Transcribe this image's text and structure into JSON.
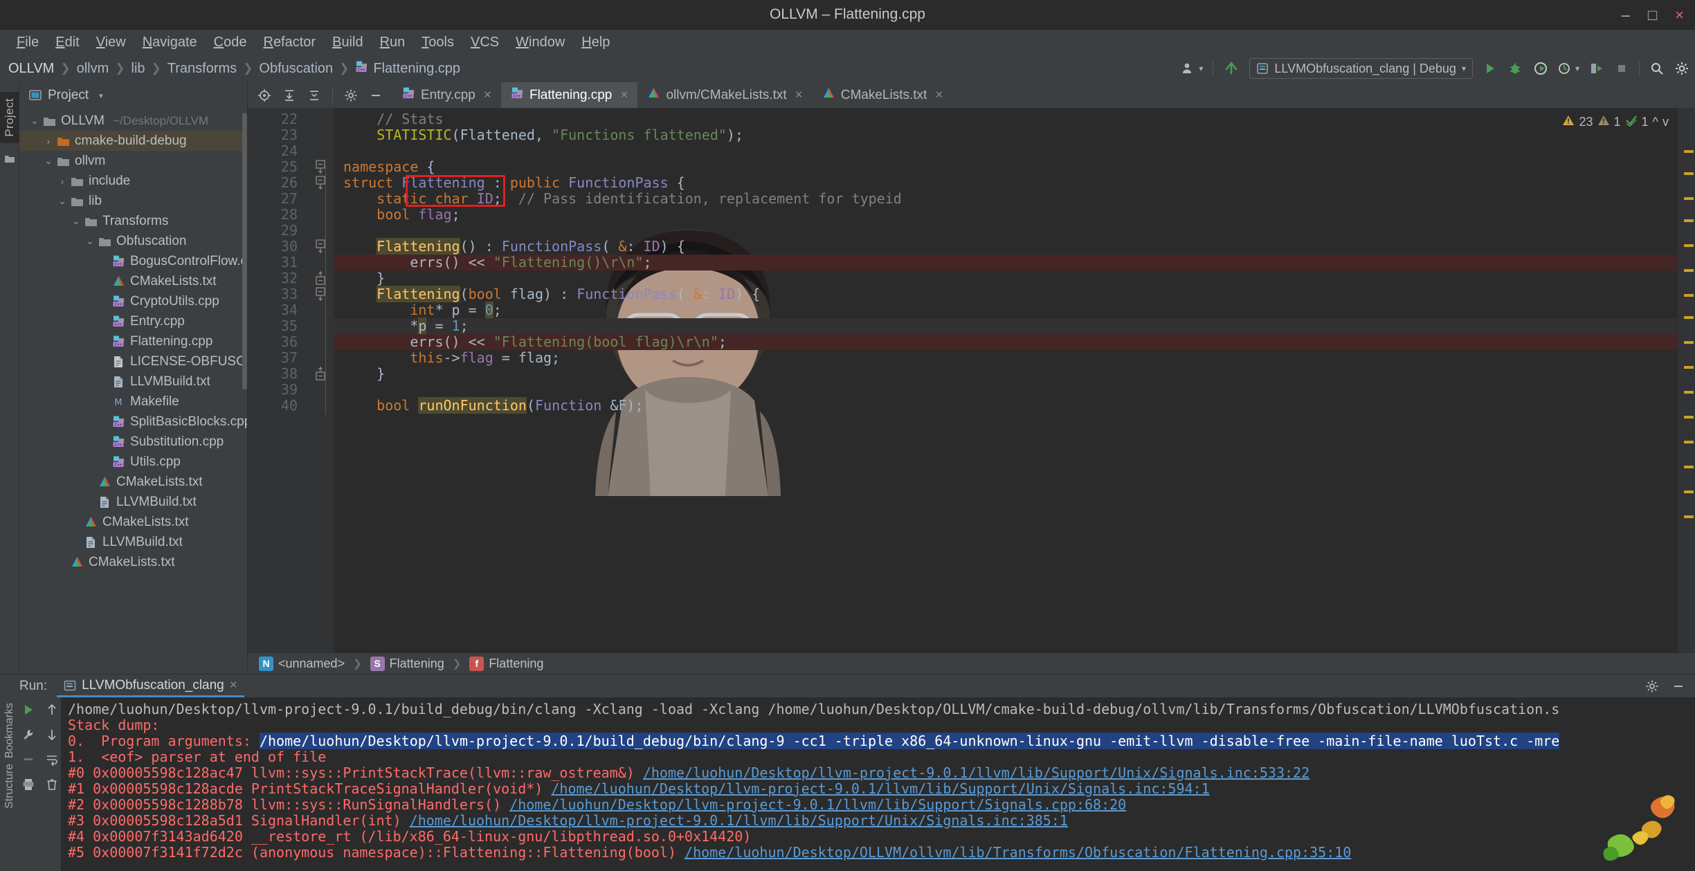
{
  "window": {
    "title": "OLLVM – Flattening.cpp",
    "minimize": "–",
    "maximize": "□",
    "close": "×"
  },
  "menubar": {
    "items": [
      "File",
      "Edit",
      "View",
      "Navigate",
      "Code",
      "Refactor",
      "Build",
      "Run",
      "Tools",
      "VCS",
      "Window",
      "Help"
    ]
  },
  "navbar": {
    "crumbs": [
      "OLLVM",
      "ollvm",
      "lib",
      "Transforms",
      "Obfuscation",
      "Flattening.cpp"
    ],
    "run_config": "LLVMObfuscation_clang | Debug",
    "run_config_icons": [
      "run-icon",
      "debug-icon",
      "run-with-coverage-icon",
      "profile-icon",
      "attach-icon",
      "stop-icon"
    ],
    "right_icons": [
      "search-icon",
      "settings-icon"
    ]
  },
  "sidebar": {
    "strip_label": "Project",
    "header": "Project",
    "tree": [
      {
        "depth": 0,
        "arrow": "v",
        "icon": "folder-icon",
        "label": "OLLVM",
        "sub": "~/Desktop/OLLVM",
        "selected": false
      },
      {
        "depth": 1,
        "arrow": ">",
        "icon": "folder-orange-icon",
        "label": "cmake-build-debug",
        "sub": "",
        "selected": true
      },
      {
        "depth": 1,
        "arrow": "v",
        "icon": "folder-icon",
        "label": "ollvm",
        "sub": "",
        "selected": false
      },
      {
        "depth": 2,
        "arrow": ">",
        "icon": "folder-icon",
        "label": "include",
        "sub": "",
        "selected": false
      },
      {
        "depth": 2,
        "arrow": "v",
        "icon": "folder-icon",
        "label": "lib",
        "sub": "",
        "selected": false
      },
      {
        "depth": 3,
        "arrow": "v",
        "icon": "folder-icon",
        "label": "Transforms",
        "sub": "",
        "selected": false
      },
      {
        "depth": 4,
        "arrow": "v",
        "icon": "folder-icon",
        "label": "Obfuscation",
        "sub": "",
        "selected": false
      },
      {
        "depth": 5,
        "arrow": "",
        "icon": "cpp-file-icon",
        "label": "BogusControlFlow.cpp",
        "sub": "",
        "selected": false
      },
      {
        "depth": 5,
        "arrow": "",
        "icon": "cmake-file-icon",
        "label": "CMakeLists.txt",
        "sub": "",
        "selected": false
      },
      {
        "depth": 5,
        "arrow": "",
        "icon": "cpp-file-icon",
        "label": "CryptoUtils.cpp",
        "sub": "",
        "selected": false
      },
      {
        "depth": 5,
        "arrow": "",
        "icon": "cpp-file-icon",
        "label": "Entry.cpp",
        "sub": "",
        "selected": false
      },
      {
        "depth": 5,
        "arrow": "",
        "icon": "cpp-file-icon",
        "label": "Flattening.cpp",
        "sub": "",
        "selected": false
      },
      {
        "depth": 5,
        "arrow": "",
        "icon": "text-file-icon",
        "label": "LICENSE-OBFUSCATOR.TXT",
        "sub": "",
        "selected": false
      },
      {
        "depth": 5,
        "arrow": "",
        "icon": "txt-file-icon",
        "label": "LLVMBuild.txt",
        "sub": "",
        "selected": false
      },
      {
        "depth": 5,
        "arrow": "",
        "icon": "makefile-icon",
        "label": "Makefile",
        "sub": "",
        "selected": false
      },
      {
        "depth": 5,
        "arrow": "",
        "icon": "cpp-file-icon",
        "label": "SplitBasicBlocks.cpp",
        "sub": "",
        "selected": false
      },
      {
        "depth": 5,
        "arrow": "",
        "icon": "cpp-file-icon",
        "label": "Substitution.cpp",
        "sub": "",
        "selected": false
      },
      {
        "depth": 5,
        "arrow": "",
        "icon": "cpp-file-icon",
        "label": "Utils.cpp",
        "sub": "",
        "selected": false
      },
      {
        "depth": 4,
        "arrow": "",
        "icon": "cmake-file-icon",
        "label": "CMakeLists.txt",
        "sub": "",
        "selected": false
      },
      {
        "depth": 4,
        "arrow": "",
        "icon": "txt-file-icon",
        "label": "LLVMBuild.txt",
        "sub": "",
        "selected": false
      },
      {
        "depth": 3,
        "arrow": "",
        "icon": "cmake-file-icon",
        "label": "CMakeLists.txt",
        "sub": "",
        "selected": false
      },
      {
        "depth": 3,
        "arrow": "",
        "icon": "txt-file-icon",
        "label": "LLVMBuild.txt",
        "sub": "",
        "selected": false
      },
      {
        "depth": 2,
        "arrow": "",
        "icon": "cmake-file-icon",
        "label": "CMakeLists.txt",
        "sub": "",
        "selected": false
      }
    ]
  },
  "editor": {
    "toolbar_icons": [
      "locate-icon",
      "expand-all-icon",
      "collapse-all-icon",
      "settings-icon",
      "hide-icon"
    ],
    "tabs": [
      {
        "label": "Entry.cpp",
        "icon": "cpp-file-icon",
        "active": false,
        "close": "×"
      },
      {
        "label": "Flattening.cpp",
        "icon": "cpp-file-icon",
        "active": true,
        "close": "×"
      },
      {
        "label": "ollvm/CMakeLists.txt",
        "icon": "cmake-file-icon",
        "active": false,
        "close": "×"
      },
      {
        "label": "CMakeLists.txt",
        "icon": "cmake-file-icon",
        "active": false,
        "close": "×"
      }
    ],
    "inspection": {
      "warnings": "23",
      "weak_warnings": "1",
      "typos": "1",
      "up": "^",
      "down": "v"
    },
    "first_line": 22,
    "lines": [
      {
        "n": 22,
        "marker": "",
        "fold": "",
        "bg": "",
        "tokens": [
          {
            "t": "    ",
            "c": "t"
          },
          {
            "t": "// Stats",
            "c": "c"
          }
        ]
      },
      {
        "n": 23,
        "marker": "",
        "fold": "",
        "bg": "",
        "tokens": [
          {
            "t": "    ",
            "c": "t"
          },
          {
            "t": "STATISTIC",
            "c": "mac"
          },
          {
            "t": "(Flattened, ",
            "c": "t"
          },
          {
            "t": "\"Functions flattened\"",
            "c": "s"
          },
          {
            "t": ");",
            "c": "t"
          }
        ]
      },
      {
        "n": 24,
        "marker": "",
        "fold": "",
        "bg": "",
        "tokens": []
      },
      {
        "n": 25,
        "marker": "",
        "fold": "minus",
        "bg": "",
        "tokens": [
          {
            "t": "namespace",
            "c": "k"
          },
          {
            "t": " {",
            "c": "t"
          }
        ]
      },
      {
        "n": 26,
        "marker": "override",
        "fold": "minus",
        "bg": "",
        "tokens": [
          {
            "t": "struct",
            "c": "k"
          },
          {
            "t": " ",
            "c": "t"
          },
          {
            "t": "Flattening",
            "c": "ty"
          },
          {
            "t": " : ",
            "c": "t"
          },
          {
            "t": "public",
            "c": "k"
          },
          {
            "t": " ",
            "c": "t"
          },
          {
            "t": "FunctionPass",
            "c": "ty"
          },
          {
            "t": " {",
            "c": "t"
          }
        ]
      },
      {
        "n": 27,
        "marker": "impl",
        "fold": "",
        "bg": "",
        "tokens": [
          {
            "t": "    ",
            "c": "t"
          },
          {
            "t": "static",
            "c": "k"
          },
          {
            "t": " ",
            "c": "t"
          },
          {
            "t": "char",
            "c": "k"
          },
          {
            "t": " ",
            "c": "t"
          },
          {
            "t": "ID",
            "c": "fld"
          },
          {
            "t": ";  ",
            "c": "t"
          },
          {
            "t": "// Pass identification, replacement for typeid",
            "c": "c"
          }
        ]
      },
      {
        "n": 28,
        "marker": "",
        "fold": "",
        "bg": "",
        "tokens": [
          {
            "t": "    ",
            "c": "t"
          },
          {
            "t": "bool",
            "c": "k"
          },
          {
            "t": " ",
            "c": "t"
          },
          {
            "t": "flag",
            "c": "fld"
          },
          {
            "t": ";",
            "c": "t"
          }
        ]
      },
      {
        "n": 29,
        "marker": "",
        "fold": "",
        "bg": "",
        "tokens": []
      },
      {
        "n": 30,
        "marker": "",
        "fold": "minus",
        "bg": "",
        "tokens": [
          {
            "t": "    ",
            "c": "t"
          },
          {
            "t": "Flattening",
            "c": "fn hl"
          },
          {
            "t": "() : ",
            "c": "t"
          },
          {
            "t": "FunctionPass",
            "c": "ty"
          },
          {
            "t": "( ",
            "c": "t"
          },
          {
            "t": "&",
            "c": "k"
          },
          {
            "t": ": ",
            "c": "t"
          },
          {
            "t": "ID",
            "c": "fld"
          },
          {
            "t": ") {",
            "c": "t"
          }
        ]
      },
      {
        "n": 31,
        "marker": "breakpoint",
        "fold": "",
        "bg": "err",
        "tokens": [
          {
            "t": "        ",
            "c": "t"
          },
          {
            "t": "errs",
            "c": "t"
          },
          {
            "t": "() << ",
            "c": "t"
          },
          {
            "t": "\"Flattening()\\r\\n\"",
            "c": "s"
          },
          {
            "t": ";",
            "c": "t"
          }
        ]
      },
      {
        "n": 32,
        "marker": "",
        "fold": "plus",
        "bg": "",
        "tokens": [
          {
            "t": "    }",
            "c": "t"
          }
        ]
      },
      {
        "n": 33,
        "marker": "",
        "fold": "minus",
        "bg": "",
        "tokens": [
          {
            "t": "    ",
            "c": "t"
          },
          {
            "t": "Flattening",
            "c": "fn hl"
          },
          {
            "t": "(",
            "c": "t"
          },
          {
            "t": "bool",
            "c": "k"
          },
          {
            "t": " flag) : ",
            "c": "t"
          },
          {
            "t": "FunctionPass",
            "c": "ty"
          },
          {
            "t": "( ",
            "c": "t"
          },
          {
            "t": "&",
            "c": "k"
          },
          {
            "t": ": ",
            "c": "t"
          },
          {
            "t": "ID",
            "c": "fld"
          },
          {
            "t": ") {",
            "c": "t"
          }
        ]
      },
      {
        "n": 34,
        "marker": "",
        "fold": "",
        "bg": "",
        "tokens": [
          {
            "t": "        ",
            "c": "t"
          },
          {
            "t": "int",
            "c": "k"
          },
          {
            "t": "* p = ",
            "c": "t"
          },
          {
            "t": "0",
            "c": "num hlnum"
          },
          {
            "t": ";",
            "c": "t"
          }
        ]
      },
      {
        "n": 35,
        "marker": "",
        "fold": "",
        "bg": "cur",
        "tokens": [
          {
            "t": "        *",
            "c": "t"
          },
          {
            "t": "p",
            "c": "t hl"
          },
          {
            "t": " = ",
            "c": "t"
          },
          {
            "t": "1",
            "c": "num"
          },
          {
            "t": ";",
            "c": "t"
          }
        ]
      },
      {
        "n": 36,
        "marker": "breakpoint",
        "fold": "",
        "bg": "err",
        "tokens": [
          {
            "t": "        ",
            "c": "t"
          },
          {
            "t": "errs",
            "c": "t"
          },
          {
            "t": "() << ",
            "c": "t"
          },
          {
            "t": "\"Flattening(bool flag)\\r\\n\"",
            "c": "s"
          },
          {
            "t": ";",
            "c": "t"
          }
        ]
      },
      {
        "n": 37,
        "marker": "",
        "fold": "",
        "bg": "",
        "tokens": [
          {
            "t": "        ",
            "c": "t"
          },
          {
            "t": "this",
            "c": "k"
          },
          {
            "t": "->",
            "c": "t"
          },
          {
            "t": "flag",
            "c": "fld"
          },
          {
            "t": " = flag;",
            "c": "t"
          }
        ]
      },
      {
        "n": 38,
        "marker": "",
        "fold": "plus",
        "bg": "",
        "tokens": [
          {
            "t": "    }",
            "c": "t"
          }
        ]
      },
      {
        "n": 39,
        "marker": "",
        "fold": "",
        "bg": "",
        "tokens": []
      },
      {
        "n": 40,
        "marker": "override-green",
        "fold": "",
        "bg": "",
        "tokens": [
          {
            "t": "    ",
            "c": "t"
          },
          {
            "t": "bool",
            "c": "k"
          },
          {
            "t": " ",
            "c": "t"
          },
          {
            "t": "runOnFunction",
            "c": "fn hl"
          },
          {
            "t": "(",
            "c": "t"
          },
          {
            "t": "Function",
            "c": "ty"
          },
          {
            "t": " &F);",
            "c": "t"
          }
        ]
      }
    ],
    "breadcrumb": [
      {
        "badge": "N",
        "label": "<unnamed>",
        "color": "#3592c4"
      },
      {
        "badge": "S",
        "label": "Flattening",
        "color": "#9876aa"
      },
      {
        "badge": "f",
        "label": "Flattening",
        "color": "#c75450"
      }
    ]
  },
  "run_panel": {
    "label": "Run:",
    "tab": "LLVMObfuscation_clang",
    "tab_close": "×",
    "header_icons": [
      "settings-icon",
      "minimize-icon"
    ],
    "tool_icons": [
      "rerun-icon",
      "scroll-up-icon",
      "wrench-icon",
      "scroll-down-icon",
      "stop-icon",
      "soft-wrap-icon",
      "print-icon",
      "clear-all-icon"
    ],
    "left_strip_labels": [
      "Bookmarks",
      "Structure"
    ],
    "console": [
      {
        "cls": "",
        "parts": [
          {
            "t": "/home/luohun/Desktop/llvm-project-9.0.1/build_debug/bin/clang -Xclang -load -Xclang /home/luohun/Desktop/OLLVM/cmake-build-debug/ollvm/lib/Transforms/Obfuscation/LLVMObfuscation.s",
            "k": "plain"
          }
        ]
      },
      {
        "cls": "red",
        "parts": [
          {
            "t": "Stack dump:",
            "k": "plain"
          }
        ]
      },
      {
        "cls": "red",
        "parts": [
          {
            "t": "0.  Program arguments: ",
            "k": "plain"
          },
          {
            "t": "/home/luohun/Desktop/llvm-project-9.0.1/build_debug/bin/clang-9 -cc1 -triple x86_64-unknown-linux-gnu -emit-llvm -disable-free -main-file-name luoTst.c -mre",
            "k": "sel"
          }
        ]
      },
      {
        "cls": "red",
        "parts": [
          {
            "t": "1.  <eof> parser at end of file",
            "k": "plain"
          }
        ]
      },
      {
        "cls": "red",
        "parts": [
          {
            "t": "#0 0x00005598c128ac47 llvm::sys::PrintStackTrace(llvm::raw_ostream&) ",
            "k": "plain"
          },
          {
            "t": "/home/luohun/Desktop/llvm-project-9.0.1/llvm/lib/Support/Unix/Signals.inc:533:22",
            "k": "link"
          }
        ]
      },
      {
        "cls": "red",
        "parts": [
          {
            "t": "#1 0x00005598c128acde PrintStackTraceSignalHandler(void*) ",
            "k": "plain"
          },
          {
            "t": "/home/luohun/Desktop/llvm-project-9.0.1/llvm/lib/Support/Unix/Signals.inc:594:1",
            "k": "link"
          }
        ]
      },
      {
        "cls": "red",
        "parts": [
          {
            "t": "#2 0x00005598c1288b78 llvm::sys::RunSignalHandlers() ",
            "k": "plain"
          },
          {
            "t": "/home/luohun/Desktop/llvm-project-9.0.1/llvm/lib/Support/Signals.cpp:68:20",
            "k": "link"
          }
        ]
      },
      {
        "cls": "red",
        "parts": [
          {
            "t": "#3 0x00005598c128a5d1 SignalHandler(int) ",
            "k": "plain"
          },
          {
            "t": "/home/luohun/Desktop/llvm-project-9.0.1/llvm/lib/Support/Unix/Signals.inc:385:1",
            "k": "link"
          }
        ]
      },
      {
        "cls": "red",
        "parts": [
          {
            "t": "#4 0x00007f3143ad6420 __restore_rt (/lib/x86_64-linux-gnu/libpthread.so.0+0x14420)",
            "k": "plain"
          }
        ]
      },
      {
        "cls": "red",
        "parts": [
          {
            "t": "#5 0x00007f3141f72d2c (anonymous namespace)::Flattening::Flattening(bool) ",
            "k": "plain"
          },
          {
            "t": "/home/luohun/Desktop/OLLVM/ollvm/lib/Transforms/Obfuscation/Flattening.cpp:35:10",
            "k": "link"
          }
        ]
      }
    ]
  }
}
